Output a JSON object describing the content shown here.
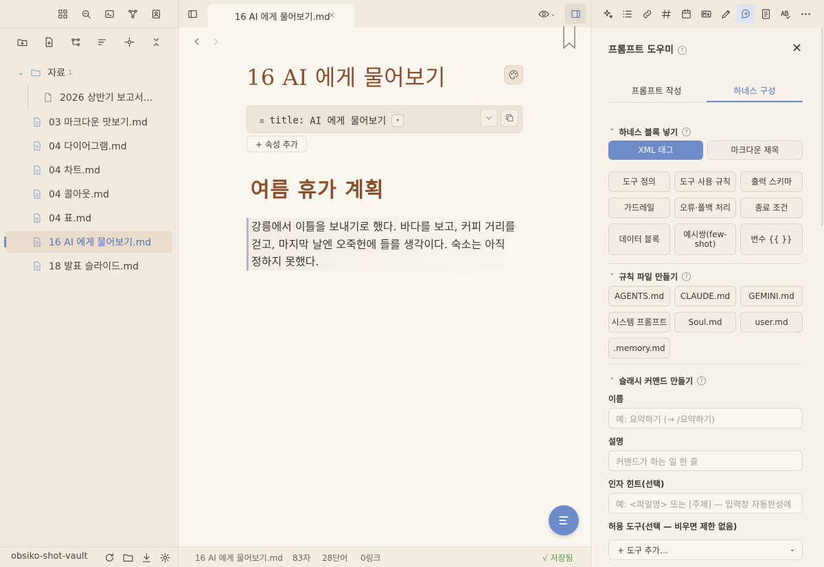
{
  "sidebar": {
    "folder": {
      "name": "자료",
      "count": "1"
    },
    "items": [
      {
        "label": "2026 상반기 보고서…"
      },
      {
        "label": "03 마크다운 맛보기.md"
      },
      {
        "label": "04 다이어그램.md"
      },
      {
        "label": "04 차트.md"
      },
      {
        "label": "04 콜아웃.md"
      },
      {
        "label": "04 표.md"
      },
      {
        "label": "16 AI 에게 물어보기.md"
      },
      {
        "label": "18 발표 슬라이드.md"
      }
    ],
    "vault_name": "obsiko-shot-vault"
  },
  "tab": {
    "title": "16 AI 에게 물어보기.md",
    "close": "×"
  },
  "doc": {
    "title": "16 AI 에게 물어보기",
    "property_key": "title:",
    "property_value": "AI 에게 물어보기",
    "add_property": "+ 속성 추가",
    "heading": "여름 휴가 계획",
    "paragraph": "강릉에서 이틀을 보내기로 했다. 바다를 보고, 커피 거리를 걷고, 마지막 날엔 오죽헌에 들를 생각이다. 숙소는 아직 정하지 못했다."
  },
  "status": {
    "file": "16 AI 에게 물어보기.md",
    "chars": "83자",
    "words": "28단어",
    "links": "0링크",
    "saved": "√ 저장됨"
  },
  "panel": {
    "title": "프롬프트 도우미",
    "tabs": [
      "프롬프트 작성",
      "하네스 구성"
    ],
    "harness_section": "하네스 블록 넣기",
    "harness_chips": [
      "XML 태그",
      "마크다운 제목",
      "도구 정의",
      "도구 사용 규칙",
      "출력 스키마",
      "가드레일",
      "오류·폴백 처리",
      "종료 조건",
      "데이터 블록",
      "예시쌍(few-shot)",
      "변수 {{ }}"
    ],
    "rules_section": "규칙 파일 만들기",
    "rules_chips": [
      "AGENTS.md",
      "CLAUDE.md",
      "GEMINI.md",
      "시스템 프롬프트",
      "Soul.md",
      "user.md",
      ".memory.md"
    ],
    "slash_section": "슬래시 커맨드 만들기",
    "name_label": "이름",
    "name_placeholder": "예: 요약하기 (→ /요약하기)",
    "desc_label": "설명",
    "desc_placeholder": "커맨드가 하는 일 한 줄",
    "arg_label": "인자 힌트(선택)",
    "arg_placeholder": "예: <파일명> 또는 [주제] — 입력창 자동완성에",
    "tools_label": "허용 도구(선택 — 비우면 제한 없음)",
    "tools_select": "+ 도구 추가…"
  },
  "colors": {
    "accent": "#6d8cc7",
    "heading": "#8a4e2c",
    "saved": "#5a9a4e"
  }
}
